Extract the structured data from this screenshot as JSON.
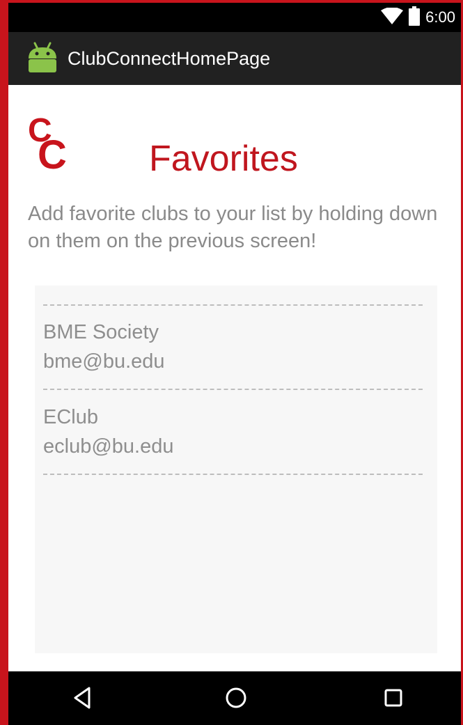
{
  "status_bar": {
    "time": "6:00",
    "icons": [
      "wifi-icon",
      "battery-icon"
    ]
  },
  "app_bar": {
    "title": "ClubConnectHomePage",
    "icon": "android-icon"
  },
  "logo": {
    "text": "CC",
    "color": "#c8141c"
  },
  "page": {
    "title": "Favorites",
    "instructions": "Add favorite clubs to your list by holding down on them on the previous screen!"
  },
  "favorites": [
    {
      "name": "BME Society",
      "email": "bme@bu.edu"
    },
    {
      "name": "EClub",
      "email": "eclub@bu.edu"
    }
  ],
  "nav_bar": {
    "buttons": [
      "back-icon",
      "home-icon",
      "recents-icon"
    ]
  },
  "colors": {
    "accent": "#c0161e",
    "status_bar": "#000000",
    "app_bar": "#212121",
    "text_secondary": "#8a8a8a"
  }
}
